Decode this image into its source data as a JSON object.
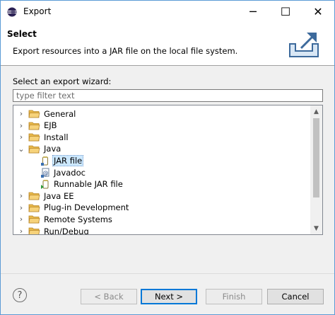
{
  "window": {
    "title": "Export"
  },
  "header": {
    "title": "Select",
    "description": "Export resources into a JAR file on the local file system."
  },
  "wizard": {
    "label": "Select an export wizard:",
    "filter_placeholder": "type filter text",
    "tree": [
      {
        "label": "General",
        "type": "folder",
        "expanded": false,
        "level": 0
      },
      {
        "label": "EJB",
        "type": "folder",
        "expanded": false,
        "level": 0
      },
      {
        "label": "Install",
        "type": "folder",
        "expanded": false,
        "level": 0
      },
      {
        "label": "Java",
        "type": "folder",
        "expanded": true,
        "level": 0
      },
      {
        "label": "JAR file",
        "type": "jar",
        "level": 1,
        "selected": true
      },
      {
        "label": "Javadoc",
        "type": "javadoc",
        "level": 1
      },
      {
        "label": "Runnable JAR file",
        "type": "runnable-jar",
        "level": 1
      },
      {
        "label": "Java EE",
        "type": "folder",
        "expanded": false,
        "level": 0
      },
      {
        "label": "Plug-in Development",
        "type": "folder",
        "expanded": false,
        "level": 0
      },
      {
        "label": "Remote Systems",
        "type": "folder",
        "expanded": false,
        "level": 0
      },
      {
        "label": "Run/Debug",
        "type": "folder",
        "expanded": false,
        "level": 0
      }
    ]
  },
  "buttons": {
    "help": "?",
    "back": "< Back",
    "next": "Next >",
    "finish": "Finish",
    "cancel": "Cancel"
  },
  "icons": {
    "minimize": "─",
    "maximize": "☐",
    "close": "✕",
    "collapsed": "›",
    "expanded": "⌄",
    "scroll_up": "▲",
    "scroll_down": "▼"
  },
  "colors": {
    "accent": "#0078d7",
    "selection": "#cce8ff",
    "folder": "#e8b94a"
  }
}
